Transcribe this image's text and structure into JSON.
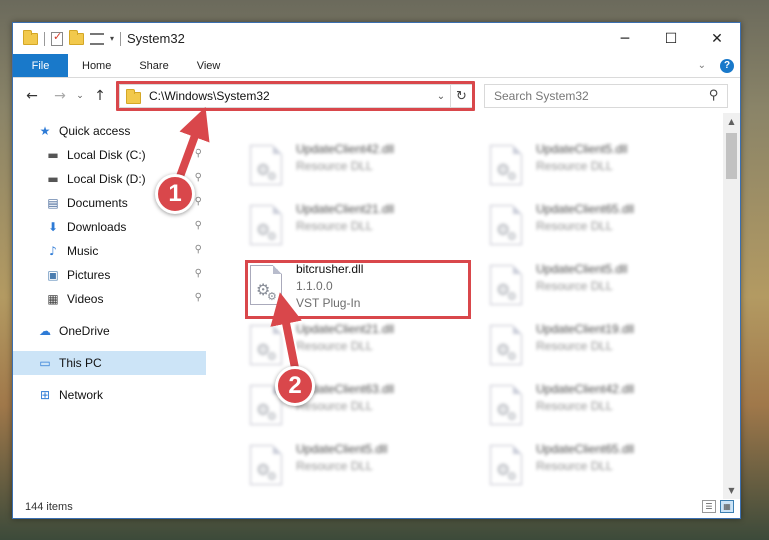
{
  "window": {
    "title": "System32",
    "controls": {
      "minimize": "─",
      "maximize": "☐",
      "close": "✕"
    }
  },
  "ribbon": {
    "tabs": [
      "File",
      "Home",
      "Share",
      "View"
    ],
    "collapse_icon": "chevron-down-icon",
    "help": "?"
  },
  "navigation": {
    "back": "←",
    "forward": "→",
    "recent": "⌄",
    "up": "↑",
    "address": "C:\\Windows\\System32",
    "address_dropdown": "⌄",
    "refresh": "↻",
    "search_placeholder": "Search System32",
    "search_icon": "⚲"
  },
  "sidebar": {
    "items": [
      {
        "label": "Quick access",
        "icon": "star-icon",
        "glyph": "★",
        "color": "#2e7bd6",
        "pinned": false
      },
      {
        "label": "Local Disk (C:)",
        "icon": "windows-drive-icon",
        "glyph": "▬",
        "color": "#555555",
        "pinned": true
      },
      {
        "label": "Local Disk (D:)",
        "icon": "drive-icon",
        "glyph": "▬",
        "color": "#555555",
        "pinned": true
      },
      {
        "label": "Documents",
        "icon": "documents-icon",
        "glyph": "▤",
        "color": "#4a6b9c",
        "pinned": true
      },
      {
        "label": "Downloads",
        "icon": "downloads-icon",
        "glyph": "⬇",
        "color": "#2e7bd6",
        "pinned": true
      },
      {
        "label": "Music",
        "icon": "music-icon",
        "glyph": "♪",
        "color": "#2e7bd6",
        "pinned": true
      },
      {
        "label": "Pictures",
        "icon": "pictures-icon",
        "glyph": "▣",
        "color": "#4a7db0",
        "pinned": true
      },
      {
        "label": "Videos",
        "icon": "videos-icon",
        "glyph": "▦",
        "color": "#444444",
        "pinned": true
      },
      {
        "label": "OneDrive",
        "icon": "onedrive-icon",
        "glyph": "☁",
        "color": "#2e7bd6",
        "pinned": false
      },
      {
        "label": "This PC",
        "icon": "this-pc-icon",
        "glyph": "▭",
        "color": "#2e7bd6",
        "pinned": false,
        "selected": true
      },
      {
        "label": "Network",
        "icon": "network-icon",
        "glyph": "⊞",
        "color": "#2e7bd6",
        "pinned": false
      }
    ],
    "pin_glyph": "📌"
  },
  "files": [
    {
      "name": "UpdateClient42.dll",
      "line2": "Resource DLL",
      "blurred": true
    },
    {
      "name": "UpdateClient5.dll",
      "line2": "Resource DLL",
      "blurred": true
    },
    {
      "name": "UpdateClient21.dll",
      "line2": "Resource DLL",
      "blurred": true
    },
    {
      "name": "UpdateClient65.dll",
      "line2": "Resource DLL",
      "blurred": true
    },
    {
      "name": "bitcrusher.dll",
      "line2": "1.1.0.0",
      "line3": "VST Plug-In",
      "blurred": false
    },
    {
      "name": "UpdateClient5.dll",
      "line2": "Resource DLL",
      "blurred": true
    },
    {
      "name": "UpdateClient21.dll",
      "line2": "Resource DLL",
      "blurred": true
    },
    {
      "name": "UpdateClient19.dll",
      "line2": "Resource DLL",
      "blurred": true
    },
    {
      "name": "UpdateClient63.dll",
      "line2": "Resource DLL",
      "blurred": true
    },
    {
      "name": "UpdateClient42.dll",
      "line2": "Resource DLL",
      "blurred": true
    },
    {
      "name": "UpdateClient5.dll",
      "line2": "Resource DLL",
      "blurred": true
    },
    {
      "name": "UpdateClient65.dll",
      "line2": "Resource DLL",
      "blurred": true
    }
  ],
  "status": {
    "item_count": "144 items"
  },
  "annotations": {
    "step1": "1",
    "step2": "2",
    "color": "#d9474b"
  }
}
